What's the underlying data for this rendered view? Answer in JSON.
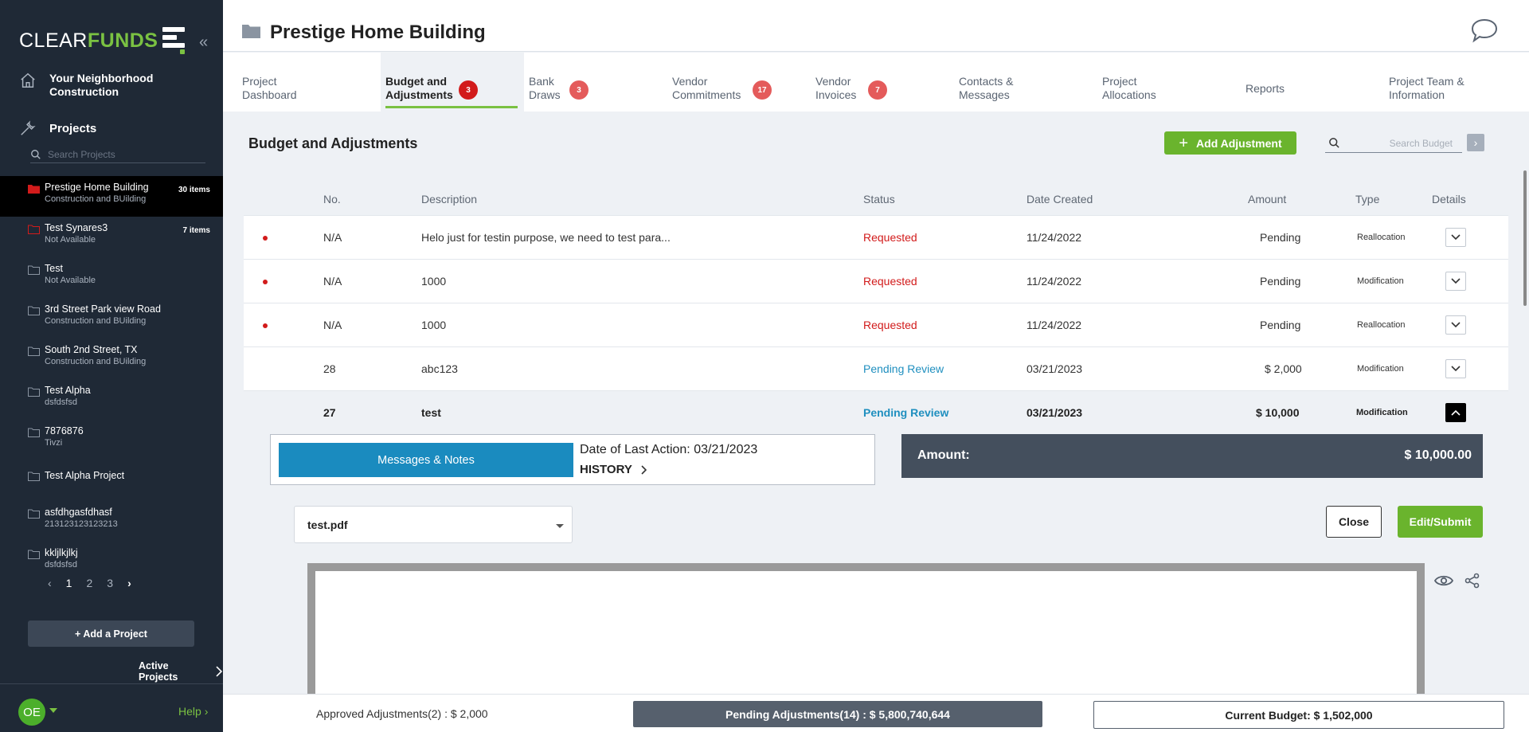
{
  "sidebar": {
    "logo_light": "CLEAR",
    "logo_bold": "FUNDS",
    "company": "Your Neighborhood Construction",
    "projects_label": "Projects",
    "search_placeholder": "Search Projects",
    "projects": [
      {
        "name": "Prestige Home Building",
        "sub": "Construction and BUilding",
        "badge": "30 items",
        "active": true
      },
      {
        "name": "Test Synares3",
        "sub": "Not Available",
        "badge": "7 items"
      },
      {
        "name": "Test",
        "sub": "Not Available",
        "badge": ""
      },
      {
        "name": "3rd Street Park view Road",
        "sub": "Construction and BUilding",
        "badge": ""
      },
      {
        "name": "South 2nd Street, TX",
        "sub": "Construction and BUilding",
        "badge": ""
      },
      {
        "name": "Test Alpha",
        "sub": "dsfdsfsd",
        "badge": ""
      },
      {
        "name": "7876876",
        "sub": "Tivzi",
        "badge": ""
      },
      {
        "name": "Test Alpha Project",
        "sub": "",
        "badge": ""
      },
      {
        "name": "asfdhgasfdhasf",
        "sub": "213123123123213",
        "badge": ""
      },
      {
        "name": "kkljlkjlkj",
        "sub": "dsfdsfsd",
        "badge": ""
      }
    ],
    "pages": [
      "1",
      "2",
      "3"
    ],
    "add_project": "+ Add a Project",
    "active_projects": "Active Projects",
    "avatar": "OE",
    "help": "Help"
  },
  "header": {
    "title": "Prestige Home Building"
  },
  "tabs": [
    {
      "line1": "Project",
      "line2": "Dashboard",
      "badge": ""
    },
    {
      "line1": "Budget and",
      "line2": "Adjustments",
      "badge": "3",
      "active": true
    },
    {
      "line1": "Bank",
      "line2": "Draws",
      "badge": "3"
    },
    {
      "line1": "Vendor",
      "line2": "Commitments",
      "badge": "17"
    },
    {
      "line1": "Vendor",
      "line2": "Invoices",
      "badge": "7"
    },
    {
      "line1": "Contacts &",
      "line2": "Messages",
      "badge": ""
    },
    {
      "line1": "Project",
      "line2": "Allocations",
      "badge": ""
    },
    {
      "line1": "Reports",
      "line2": "",
      "badge": ""
    },
    {
      "line1": "Project Team &",
      "line2": "Information",
      "badge": ""
    }
  ],
  "main": {
    "section_title": "Budget and Adjustments",
    "add_adjustment": "Add Adjustment",
    "search_placeholder": "Search Budget",
    "columns": [
      "No.",
      "Description",
      "Status",
      "Date Created",
      "Amount",
      "Type",
      "Details"
    ],
    "rows": [
      {
        "flag": true,
        "no": "N/A",
        "desc": "Helo just for testin purpose, we need to test para...",
        "status": "Requested",
        "date": "11/24/2022",
        "amount": "Pending",
        "type": "Reallocation"
      },
      {
        "flag": true,
        "no": "N/A",
        "desc": "1000",
        "status": "Requested",
        "date": "11/24/2022",
        "amount": "Pending",
        "type": "Modification"
      },
      {
        "flag": true,
        "no": "N/A",
        "desc": "1000",
        "status": "Requested",
        "date": "11/24/2022",
        "amount": "Pending",
        "type": "Reallocation"
      },
      {
        "flag": false,
        "no": "28",
        "desc": "abc123",
        "status": "Pending Review",
        "date": "03/21/2023",
        "amount": "$ 2,000",
        "type": "Modification"
      },
      {
        "flag": false,
        "no": "27",
        "desc": "test",
        "status": "Pending Review",
        "date": "03/21/2023",
        "amount": "$ 10,000",
        "type": "Modification",
        "expanded": true
      }
    ],
    "detail": {
      "messages_button": "Messages & Notes",
      "last_action": "Date of Last Action: 03/21/2023",
      "history": "HISTORY",
      "amount_label": "Amount:",
      "amount_value": "$  10,000.00",
      "file": "test.pdf",
      "close": "Close",
      "edit_submit": "Edit/Submit"
    }
  },
  "footer": {
    "approved": "Approved Adjustments(2) : $ 2,000",
    "pending": "Pending Adjustments(14) : $ 5,800,740,644",
    "current": "Current Budget: $ 1,502,000"
  },
  "colors": {
    "sidebar_bg": "#1f2936",
    "accent_green": "#6ab42d",
    "requested_red": "#d21b1b",
    "pending_blue": "#1f8fbf"
  }
}
